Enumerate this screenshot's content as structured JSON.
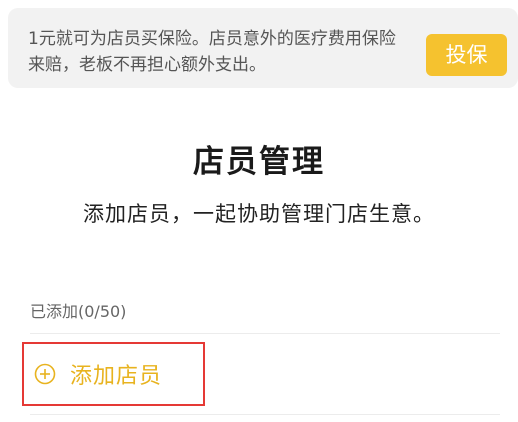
{
  "banner": {
    "text": "1元就可为店员买保险。店员意外的医疗费用保险来赔，老板不再担心额外支出。",
    "button_label": "投保"
  },
  "header": {
    "title": "店员管理",
    "subtitle": "添加店员，一起协助管理门店生意。"
  },
  "staff": {
    "added_label": "已添加(0/50)",
    "add_button_label": "添加店员",
    "add_icon": "plus-circle-icon"
  },
  "colors": {
    "accent": "#f5c22f",
    "add_text": "#e8b31f",
    "highlight_border": "#e53935"
  }
}
